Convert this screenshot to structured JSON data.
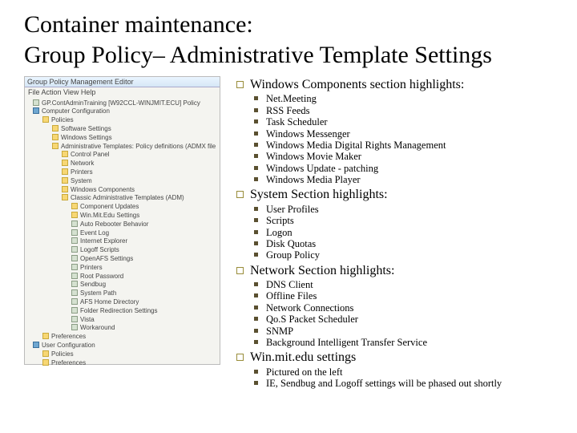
{
  "title_line1": "Container maintenance:",
  "title_line2": "Group Policy– Administrative Template Settings",
  "editor": {
    "window_title": "Group Policy Management Editor",
    "menu": "File   Action   View   Help",
    "tree": [
      {
        "level": 1,
        "icon": "doc",
        "label": "GP.ContAdminTraining [W92CCL-WINJMIT.ECU] Policy"
      },
      {
        "level": 1,
        "icon": "comp",
        "label": "Computer Configuration"
      },
      {
        "level": 2,
        "icon": "folder",
        "label": "Policies"
      },
      {
        "level": 3,
        "icon": "folder",
        "label": "Software Settings"
      },
      {
        "level": 3,
        "icon": "folder",
        "label": "Windows Settings"
      },
      {
        "level": 3,
        "icon": "folder",
        "label": "Administrative Templates: Policy definitions (ADMX file"
      },
      {
        "level": 4,
        "icon": "folder",
        "label": "Control Panel"
      },
      {
        "level": 4,
        "icon": "folder",
        "label": "Network"
      },
      {
        "level": 4,
        "icon": "folder",
        "label": "Printers"
      },
      {
        "level": 4,
        "icon": "folder",
        "label": "System"
      },
      {
        "level": 4,
        "icon": "folder",
        "label": "Windows Components"
      },
      {
        "level": 4,
        "icon": "folder",
        "label": "Classic Administrative Templates (ADM)"
      },
      {
        "level": 5,
        "icon": "folder",
        "label": "Component Updates"
      },
      {
        "level": 5,
        "icon": "folder",
        "label": "Win.Mit.Edu Settings"
      },
      {
        "level": 5,
        "icon": "doc",
        "label": "Auto Rebooter Behavior"
      },
      {
        "level": 5,
        "icon": "doc",
        "label": "Event Log"
      },
      {
        "level": 5,
        "icon": "doc",
        "label": "Internet Explorer"
      },
      {
        "level": 5,
        "icon": "doc",
        "label": "Logoff Scripts"
      },
      {
        "level": 5,
        "icon": "doc",
        "label": "OpenAFS Settings"
      },
      {
        "level": 5,
        "icon": "doc",
        "label": "Printers"
      },
      {
        "level": 5,
        "icon": "doc",
        "label": "Root Password"
      },
      {
        "level": 5,
        "icon": "doc",
        "label": "Sendbug"
      },
      {
        "level": 5,
        "icon": "doc",
        "label": "System Path"
      },
      {
        "level": 5,
        "icon": "doc",
        "label": "AFS Home Directory"
      },
      {
        "level": 5,
        "icon": "doc",
        "label": "Folder Redirection Settings"
      },
      {
        "level": 5,
        "icon": "doc",
        "label": "Vista"
      },
      {
        "level": 5,
        "icon": "doc",
        "label": "Workaround"
      },
      {
        "level": 2,
        "icon": "folder",
        "label": "Preferences"
      },
      {
        "level": 1,
        "icon": "comp",
        "label": "User Configuration"
      },
      {
        "level": 2,
        "icon": "folder",
        "label": "Policies"
      },
      {
        "level": 2,
        "icon": "folder",
        "label": "Preferences"
      }
    ]
  },
  "sections": [
    {
      "heading": "Windows Components section highlights:",
      "items": [
        "Net.Meeting",
        "RSS Feeds",
        "Task Scheduler",
        "Windows Messenger",
        "Windows Media Digital Rights Management",
        "Windows Movie Maker",
        "Windows Update - patching",
        "Windows Media Player"
      ]
    },
    {
      "heading": "System Section highlights:",
      "items": [
        "User Profiles",
        "Scripts",
        "Logon",
        "Disk Quotas",
        "Group Policy"
      ]
    },
    {
      "heading": "Network Section highlights:",
      "items": [
        "DNS Client",
        "Offline Files",
        "Network Connections",
        "Qo.S Packet Scheduler",
        "SNMP",
        "Background Intelligent Transfer Service"
      ]
    },
    {
      "heading": "Win.mit.edu settings",
      "items": [
        "Pictured on the left",
        "IE, Sendbug and Logoff settings will be phased out shortly"
      ]
    }
  ]
}
